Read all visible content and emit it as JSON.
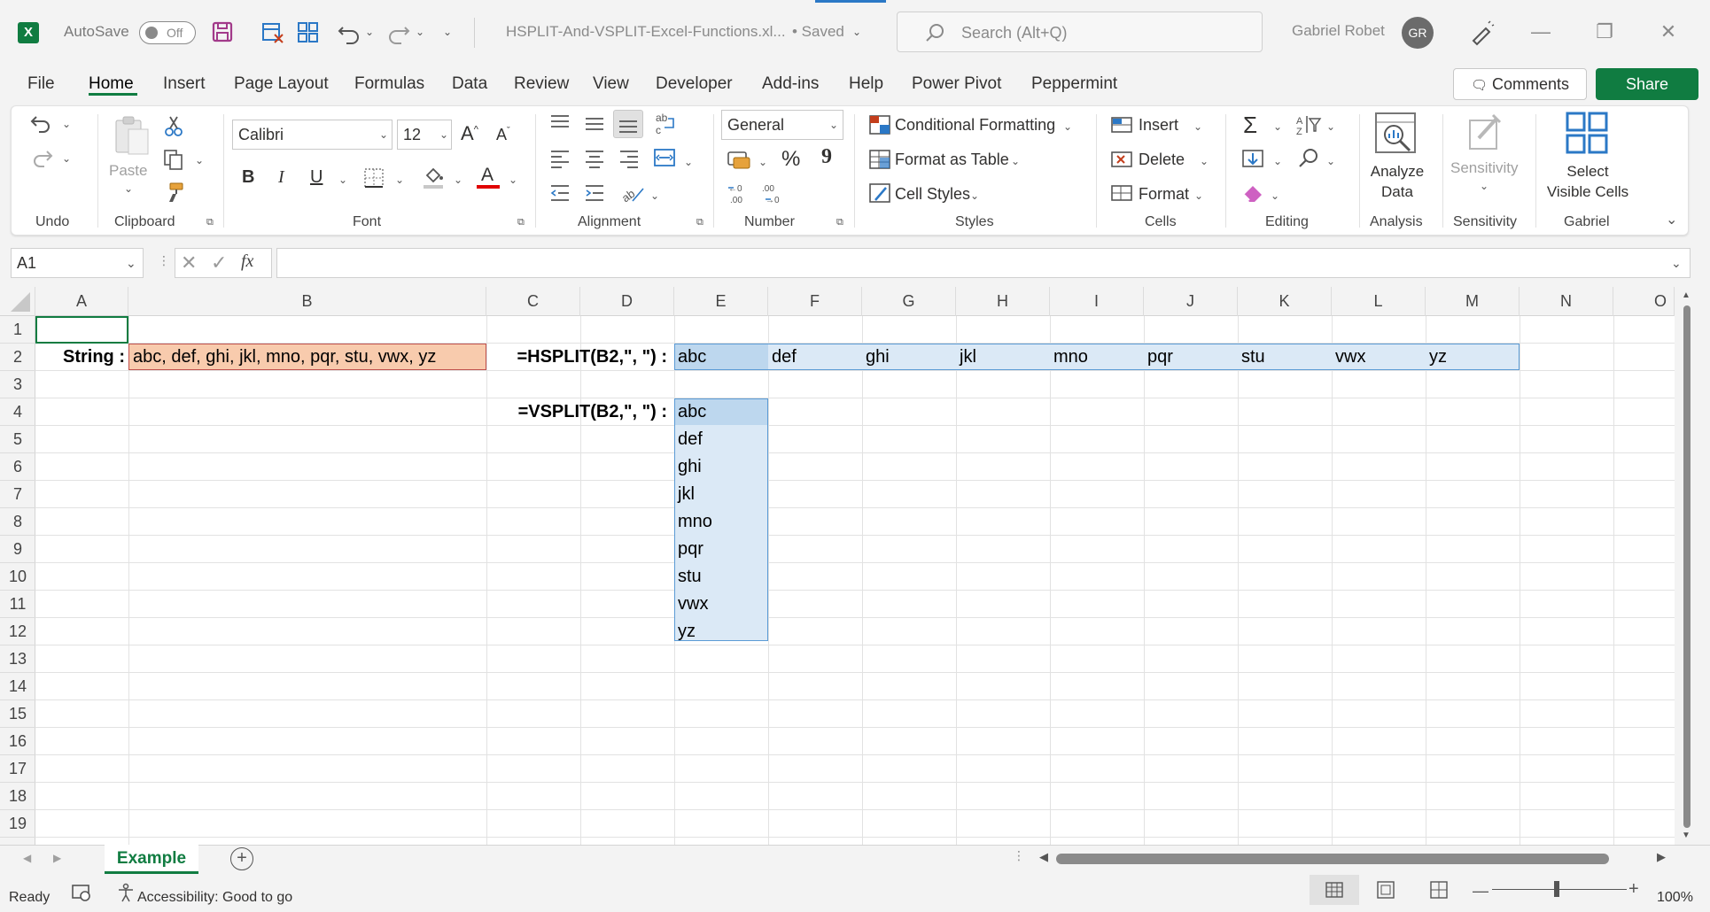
{
  "titlebar": {
    "logo_letter": "X",
    "autosave_label": "AutoSave",
    "autosave_state": "Off",
    "doc_title": "HSPLIT-And-VSPLIT-Excel-Functions.xl...",
    "doc_status": "• Saved",
    "search_placeholder": "Search (Alt+Q)",
    "user_name": "Gabriel Robet",
    "user_initials": "GR"
  },
  "menu": [
    "File",
    "Home",
    "Insert",
    "Page Layout",
    "Formulas",
    "Data",
    "Review",
    "View",
    "Developer",
    "Add-ins",
    "Help",
    "Power Pivot",
    "Peppermint"
  ],
  "actions": {
    "comments": "Comments",
    "share": "Share"
  },
  "ribbon": {
    "undo_group": "Undo",
    "clipboard": {
      "label": "Clipboard",
      "paste": "Paste"
    },
    "font": {
      "label": "Font",
      "name": "Calibri",
      "size": "12",
      "bold": "B",
      "italic": "I",
      "underline": "U",
      "font_color_letter": "A"
    },
    "alignment": {
      "label": "Alignment"
    },
    "number": {
      "label": "Number",
      "format": "General",
      "percent": "%",
      "comma": "9",
      "inc_dec": ".0←.00",
      "dec_dec": ".00→.0"
    },
    "styles": {
      "label": "Styles",
      "conditional": "Conditional Formatting",
      "format_table": "Format as Table",
      "cell_styles": "Cell Styles"
    },
    "cells": {
      "label": "Cells",
      "insert": "Insert",
      "delete": "Delete",
      "format": "Format"
    },
    "editing": {
      "label": "Editing"
    },
    "analysis": {
      "label": "Analysis",
      "analyze_line1": "Analyze",
      "analyze_line2": "Data"
    },
    "sensitivity": {
      "label": "Sensitivity",
      "button": "Sensitivity"
    },
    "gabriel": {
      "label": "Gabriel",
      "line1": "Select",
      "line2": "Visible Cells"
    }
  },
  "formula_bar": {
    "name_box": "A1",
    "fx": "fx",
    "value": ""
  },
  "columns": [
    "A",
    "B",
    "C",
    "D",
    "E",
    "F",
    "G",
    "H",
    "I",
    "J",
    "K",
    "L",
    "M",
    "N",
    "O"
  ],
  "rows": [
    "1",
    "2",
    "3",
    "4",
    "5",
    "6",
    "7",
    "8",
    "9",
    "10",
    "11",
    "12",
    "13",
    "14",
    "15",
    "16",
    "17",
    "18",
    "19"
  ],
  "cells": {
    "a2_label": "String :",
    "b2_value": "abc, def, ghi, jkl, mno, pqr, stu, vwx, yz",
    "c2_formula": "=HSPLIT(B2,\", \") :",
    "c4_formula": "=VSPLIT(B2,\", \") :",
    "hsplit": [
      "abc",
      "def",
      "ghi",
      "jkl",
      "mno",
      "pqr",
      "stu",
      "vwx",
      "yz"
    ],
    "vsplit": [
      "abc",
      "def",
      "ghi",
      "jkl",
      "mno",
      "pqr",
      "stu",
      "vwx",
      "yz"
    ]
  },
  "colors": {
    "accent": "#107c41",
    "string_cell": "#f8cbad",
    "spill_fill": "#dbe9f6",
    "spill_border": "#5b9bd5",
    "active_cell": "#bdd7ee"
  },
  "sheet_tab": "Example",
  "status": {
    "ready": "Ready",
    "accessibility": "Accessibility: Good to go",
    "zoom": "100%"
  }
}
